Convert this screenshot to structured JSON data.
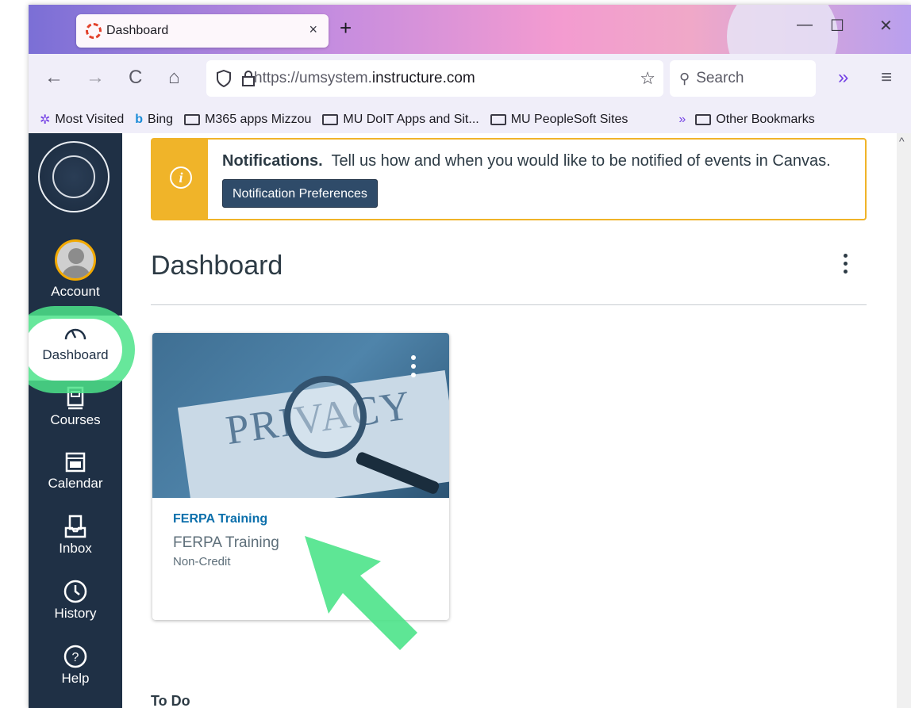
{
  "browser": {
    "tab_title": "Dashboard",
    "close_tab": "×",
    "new_tab": "+",
    "minimize": "—",
    "maximize": "☐",
    "close_window": "✕",
    "back": "←",
    "forward": "→",
    "reload": "C",
    "home": "⌂",
    "url_prefix": "https://umsystem.",
    "url_domain": "instructure.com",
    "star": "☆",
    "search_placeholder": "Search",
    "overflow": "»",
    "menu": "≡"
  },
  "bookmarks": [
    {
      "label": "Most Visited",
      "icon": "gear-icon"
    },
    {
      "label": "Bing",
      "icon": "bing-icon"
    },
    {
      "label": "M365 apps Mizzou",
      "icon": "folder-icon"
    },
    {
      "label": "MU DoIT Apps and Sit...",
      "icon": "folder-icon"
    },
    {
      "label": "MU PeopleSoft Sites",
      "icon": "folder-icon"
    }
  ],
  "bookmarks_overflow": "»",
  "other_bookmarks": "Other Bookmarks",
  "sidebar": {
    "account": "Account",
    "dashboard": "Dashboard",
    "courses": "Courses",
    "calendar": "Calendar",
    "inbox": "Inbox",
    "history": "History",
    "help": "Help"
  },
  "notification": {
    "title": "Notifications.",
    "text": "Tell us how and when you would like to be notified of events in Canvas.",
    "button": "Notification Preferences"
  },
  "main": {
    "title": "Dashboard",
    "todo": "To Do"
  },
  "card": {
    "image_text": "PRIVACY",
    "link": "FERPA Training",
    "subtitle": "FERPA Training",
    "term": "Non-Credit"
  },
  "colors": {
    "sidebar": "#1f3045",
    "notification_accent": "#f0b429",
    "link": "#0b6fab",
    "highlight": "#4ce38a"
  }
}
